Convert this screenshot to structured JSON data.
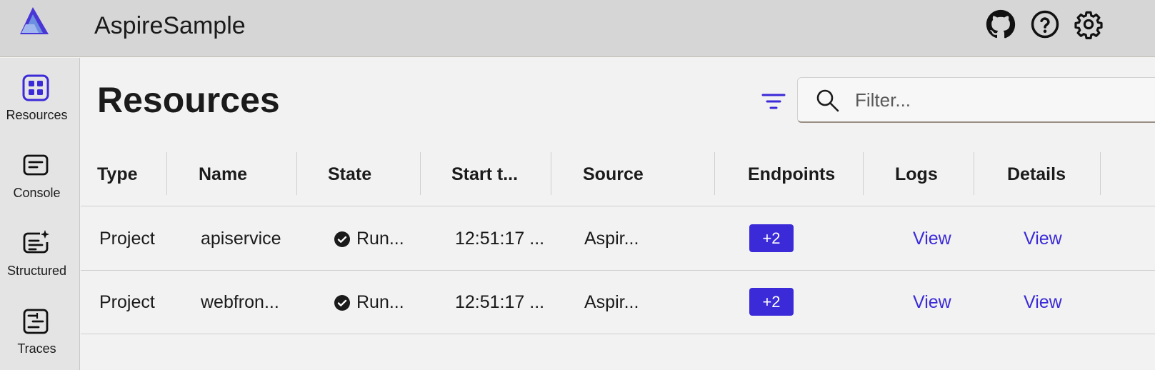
{
  "app": {
    "title": "AspireSample"
  },
  "header_icons": [
    "github-icon",
    "help-icon",
    "settings-icon"
  ],
  "sidebar": {
    "items": [
      {
        "label": "Resources",
        "icon": "resources-grid-icon",
        "active": true
      },
      {
        "label": "Console",
        "icon": "console-icon"
      },
      {
        "label": "Structured",
        "icon": "structured-logs-icon"
      },
      {
        "label": "Traces",
        "icon": "traces-icon"
      }
    ]
  },
  "page": {
    "title": "Resources",
    "filter_icon": "filter-icon",
    "search": {
      "placeholder": "Filter...",
      "value": ""
    }
  },
  "grid": {
    "columns": [
      "Type",
      "Name",
      "State",
      "Start t...",
      "Source",
      "Endpoints",
      "Logs",
      "Details"
    ],
    "rows": [
      {
        "type": "Project",
        "name": "apiservice",
        "state": "Run...",
        "start": "12:51:17 ...",
        "source": "Aspir...",
        "endpoints": "+2",
        "logs": "View",
        "details": "View"
      },
      {
        "type": "Project",
        "name": "webfron...",
        "state": "Run...",
        "start": "12:51:17 ...",
        "source": "Aspir...",
        "endpoints": "+2",
        "logs": "View",
        "details": "View"
      }
    ]
  },
  "colors": {
    "accent": "#3b2ad8",
    "header_bg": "#d6d6d6",
    "sidebar_bg": "#e4e4e4",
    "content_bg": "#f2f2f2"
  }
}
